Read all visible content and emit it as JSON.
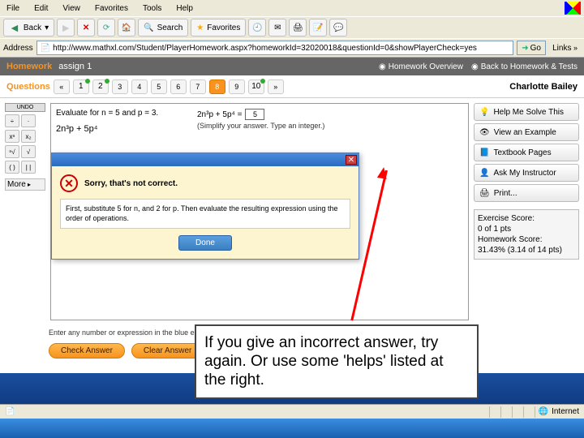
{
  "menu": {
    "file": "File",
    "edit": "Edit",
    "view": "View",
    "favorites": "Favorites",
    "tools": "Tools",
    "help": "Help"
  },
  "toolbar": {
    "back": "Back",
    "search": "Search",
    "favorites": "Favorites"
  },
  "addr": {
    "label": "Address",
    "url": "http://www.mathxl.com/Student/PlayerHomework.aspx?homeworkId=32020018&questionId=0&showPlayerCheck=yes",
    "go": "Go",
    "links": "Links"
  },
  "app": {
    "homework": "Homework",
    "assign": "assign 1",
    "overview": "Homework Overview",
    "back": "Back to Homework & Tests"
  },
  "questions": {
    "label": "Questions",
    "items": [
      "1",
      "2",
      "3",
      "4",
      "5",
      "6",
      "7",
      "8",
      "9",
      "10"
    ],
    "active": 7
  },
  "user": "Charlotte Bailey",
  "left": {
    "undo": "UNDO",
    "more": "More"
  },
  "palette": [
    [
      "÷",
      "·"
    ],
    [
      "xⁿ",
      "x₂"
    ],
    [
      "ⁿ√",
      "√"
    ],
    [
      "( )",
      "| |"
    ]
  ],
  "question": {
    "prompt": "Evaluate for n = 5 and p = 3.",
    "expr": "2n³p + 5p⁴"
  },
  "answer": {
    "lhs": "2n³p + 5p⁴ =",
    "value": "5",
    "hint": "(Simplify your answer. Type an integer.)"
  },
  "popup": {
    "title": "Sorry, that's not correct.",
    "hint": "First, substitute 5 for n, and 2 for p. Then evaluate the resulting expression using the order of operations.",
    "done": "Done"
  },
  "helps": [
    {
      "icon": "bulb",
      "label": "Help Me Solve This"
    },
    {
      "icon": "eye",
      "label": "View an Example"
    },
    {
      "icon": "book",
      "label": "Textbook Pages"
    },
    {
      "icon": "person",
      "label": "Ask My Instructor"
    },
    {
      "icon": "print",
      "label": "Print..."
    }
  ],
  "score": {
    "l1": "Exercise Score:",
    "l2": "0 of 1 pts",
    "l3": "Homework Score:",
    "l4": "31.43% (3.14 of 14 pts)"
  },
  "instruction": "Enter any number or expression in the blue edit box, then click Check Answer.",
  "buttons": {
    "check": "Check Answer",
    "clear": "Clear Answer"
  },
  "callout": "If you give an incorrect answer, try again.  Or use some 'helps' listed at the right.",
  "status": {
    "internet": "Internet"
  }
}
